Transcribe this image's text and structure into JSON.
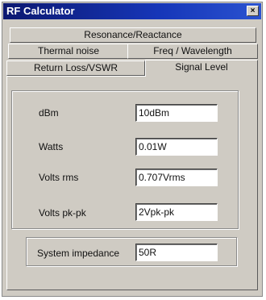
{
  "window": {
    "title": "RF Calculator",
    "close_glyph": "×"
  },
  "tabs": [
    {
      "label": "Resonance/Reactance"
    },
    {
      "label": "Thermal noise"
    },
    {
      "label": "Freq / Wavelength"
    },
    {
      "label": "Return Loss/VSWR"
    },
    {
      "label": "Signal Level"
    }
  ],
  "fields": [
    {
      "label": "dBm",
      "value": "10dBm"
    },
    {
      "label": "Watts",
      "value": "0.01W"
    },
    {
      "label": "Volts rms",
      "value": "0.707Vrms"
    },
    {
      "label": "Volts pk-pk",
      "value": "2Vpk-pk"
    }
  ],
  "impedance": {
    "label": "System impedance",
    "value": "50R"
  }
}
